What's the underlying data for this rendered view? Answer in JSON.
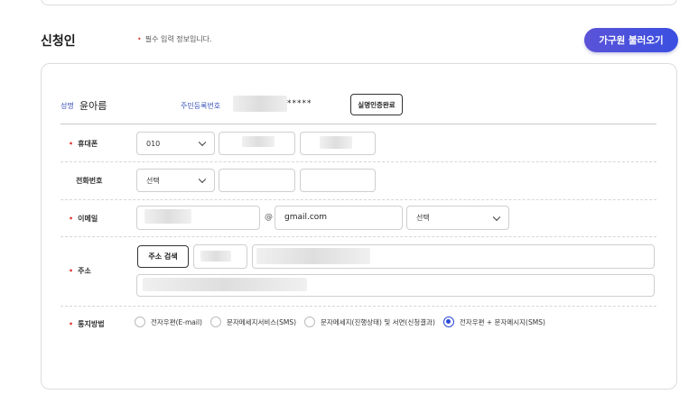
{
  "section": {
    "title": "신청인",
    "required_note": "필수 입력 정보입니다.",
    "load_button": "가구원 불러오기"
  },
  "applicant": {
    "name_label": "성명",
    "name_value": "윤아름",
    "rrn_label": "주민등록번호",
    "rrn_masked": "*****",
    "verify_button": "실명인증완료"
  },
  "mobile": {
    "label": "휴대폰",
    "prefix": "010"
  },
  "phone": {
    "label": "전화번호",
    "prefix": "선택"
  },
  "email": {
    "label": "이메일",
    "at": "@",
    "domain": "gmail.com",
    "domain_select": "선택"
  },
  "address": {
    "label": "주소",
    "search_button": "주소 검색"
  },
  "notify": {
    "label": "통지방법",
    "options": [
      "전자우편(E-mail)",
      "문자메세지서비스(SMS)",
      "문자메세지(진행상태) 및 서면(신청결과)",
      "전자우편 + 문자메시지(SMS)"
    ],
    "selected_index": 3
  },
  "colors": {
    "accent": "#3a4fe0",
    "required_dot": "#e0413b",
    "label_blue": "#3b54b8"
  }
}
